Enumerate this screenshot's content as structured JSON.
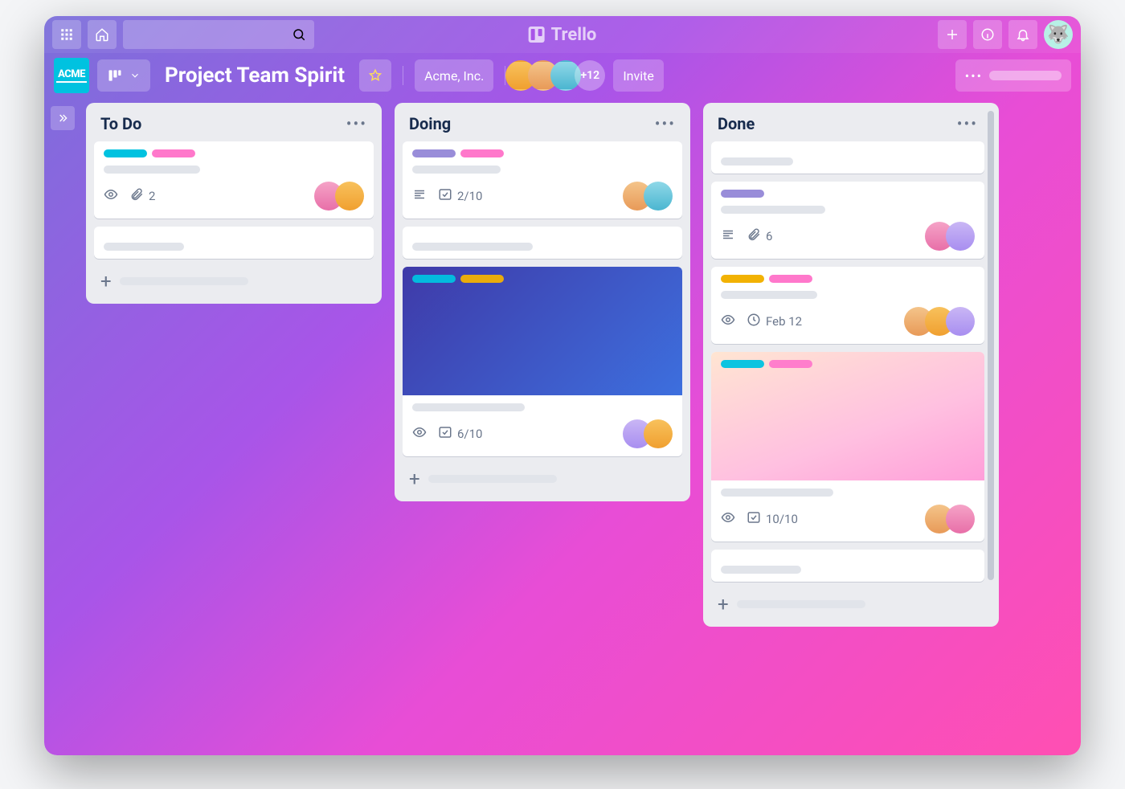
{
  "app": {
    "name": "Trello"
  },
  "topbar": {
    "search_placeholder": "",
    "apps_icon": "apps-icon",
    "home_icon": "home-icon",
    "search_icon": "search-icon",
    "plus_icon": "plus-icon",
    "info_icon": "info-icon",
    "bell_icon": "bell-icon"
  },
  "board": {
    "workspace_logo": "ACME",
    "title": "Project Team Spirit",
    "team": "Acme, Inc.",
    "star_active": false,
    "members_overflow": "+12",
    "invite_label": "Invite"
  },
  "colors": {
    "cyan": "#00c2e0",
    "pink": "#ff78cb",
    "purple": "#998dd9",
    "yellow": "#f2b203",
    "blue_grad": "linear-gradient(135deg,#3f3aa8 0%, #3d6fde 100%)",
    "pink_grad": "linear-gradient(160deg,#ffe5d2 0%, #ffc0e0 60%, #ff9ed9 100%)"
  },
  "avatars": {
    "a1": "linear-gradient(180deg,#f4c48a,#e89a58)",
    "a2": "linear-gradient(180deg,#c9b6f5,#a88ef0)",
    "a3": "linear-gradient(180deg,#8fd8e8,#4bb6d0)",
    "a4": "linear-gradient(180deg,#f5a3c7,#e86fa8)",
    "a5": "linear-gradient(180deg,#f8c15c,#f0a030)"
  },
  "lists": [
    {
      "title": "To Do",
      "cards": [
        {
          "labels": [
            "cyan",
            "pink"
          ],
          "placeholders": [
            120
          ],
          "badges": {
            "watch": true,
            "attachments": 2
          },
          "members": [
            "a4",
            "a5"
          ]
        },
        {
          "placeholders": [
            100
          ]
        }
      ]
    },
    {
      "title": "Doing",
      "cards": [
        {
          "labels": [
            "purple",
            "pink"
          ],
          "placeholders": [
            110
          ],
          "badges": {
            "description": true,
            "checklist": "2/10"
          },
          "members": [
            "a1",
            "a3"
          ]
        },
        {
          "placeholders": [
            150
          ]
        },
        {
          "cover": "blue_grad",
          "cover_labels": [
            "cyan",
            "yellow"
          ],
          "placeholders": [
            140
          ],
          "badges": {
            "watch": true,
            "checklist": "6/10"
          },
          "members": [
            "a2",
            "a5"
          ]
        }
      ]
    },
    {
      "title": "Done",
      "scroll": true,
      "cards": [
        {
          "placeholders": [
            90
          ]
        },
        {
          "labels": [
            "purple"
          ],
          "placeholders": [
            130
          ],
          "badges": {
            "description": true,
            "attachments": 6
          },
          "members": [
            "a4",
            "a2"
          ]
        },
        {
          "labels": [
            "yellow",
            "pink"
          ],
          "placeholders": [
            120
          ],
          "badges": {
            "watch": true,
            "due": "Feb 12"
          },
          "members": [
            "a1",
            "a5",
            "a2"
          ]
        },
        {
          "cover": "pink_grad",
          "cover_labels": [
            "cyan",
            "pink"
          ],
          "placeholders": [
            140
          ],
          "badges": {
            "watch": true,
            "checklist": "10/10"
          },
          "members": [
            "a1",
            "a4"
          ]
        },
        {
          "placeholders": [
            100
          ]
        }
      ]
    }
  ],
  "add_card_label": "",
  "icons": {
    "watch": "eye-icon",
    "attachment": "paperclip-icon",
    "description": "description-icon",
    "checklist": "checklist-icon",
    "due": "clock-icon"
  }
}
